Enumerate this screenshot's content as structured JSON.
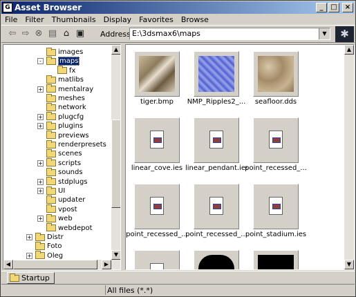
{
  "window": {
    "title": "Asset Browser",
    "icon": "3ds-max-icon",
    "controls": [
      "_",
      "□",
      "×"
    ]
  },
  "menu": [
    "File",
    "Filter",
    "Thumbnails",
    "Display",
    "Favorites",
    "Browse"
  ],
  "toolbar": {
    "icons": [
      "back-arrow-icon",
      "forward-arrow-icon",
      "stop-icon",
      "refresh-icon",
      "home-icon",
      "up-folder-icon"
    ],
    "address_label": "Address:",
    "address_value": "E:\\3dsmax6\\maps",
    "logo": "3ds-max-logo-icon"
  },
  "tree": {
    "items": [
      {
        "label": "images",
        "depth": 2,
        "expander": ""
      },
      {
        "label": "maps",
        "depth": 2,
        "expander": "-",
        "selected": true
      },
      {
        "label": "fx",
        "depth": 3,
        "expander": ""
      },
      {
        "label": "matlibs",
        "depth": 2,
        "expander": ""
      },
      {
        "label": "mentalray",
        "depth": 2,
        "expander": "+"
      },
      {
        "label": "meshes",
        "depth": 2,
        "expander": ""
      },
      {
        "label": "network",
        "depth": 2,
        "expander": ""
      },
      {
        "label": "plugcfg",
        "depth": 2,
        "expander": "+"
      },
      {
        "label": "plugins",
        "depth": 2,
        "expander": "+"
      },
      {
        "label": "previews",
        "depth": 2,
        "expander": ""
      },
      {
        "label": "renderpresets",
        "depth": 2,
        "expander": ""
      },
      {
        "label": "scenes",
        "depth": 2,
        "expander": ""
      },
      {
        "label": "scripts",
        "depth": 2,
        "expander": "+"
      },
      {
        "label": "sounds",
        "depth": 2,
        "expander": ""
      },
      {
        "label": "stdplugs",
        "depth": 2,
        "expander": "+"
      },
      {
        "label": "UI",
        "depth": 2,
        "expander": "+"
      },
      {
        "label": "updater",
        "depth": 2,
        "expander": ""
      },
      {
        "label": "vpost",
        "depth": 2,
        "expander": ""
      },
      {
        "label": "web",
        "depth": 2,
        "expander": "+"
      },
      {
        "label": "webdepot",
        "depth": 2,
        "expander": ""
      },
      {
        "label": "Distr",
        "depth": 1,
        "expander": "+"
      },
      {
        "label": "Foto",
        "depth": 1,
        "expander": ""
      },
      {
        "label": "Oleg",
        "depth": 1,
        "expander": "+"
      }
    ]
  },
  "files": [
    {
      "name": "tiger.bmp",
      "kind": "image",
      "thumb": "tiger-sketch"
    },
    {
      "name": "NMP_Ripples2_...",
      "kind": "image",
      "thumb": "ripples-blue"
    },
    {
      "name": "seafloor.dds",
      "kind": "image",
      "thumb": "seafloor-texture"
    },
    {
      "name": "linear_cove.ies",
      "kind": "doc"
    },
    {
      "name": "linear_pendant.ies",
      "kind": "doc"
    },
    {
      "name": "point_recessed_...",
      "kind": "doc"
    },
    {
      "name": "point_recessed_...",
      "kind": "doc"
    },
    {
      "name": "point_recessed_...",
      "kind": "doc"
    },
    {
      "name": "point_stadium.ies",
      "kind": "doc"
    },
    {
      "name": "",
      "kind": "doc"
    },
    {
      "name": "",
      "kind": "image",
      "thumb": "dark-silhouette"
    },
    {
      "name": "",
      "kind": "image",
      "thumb": "leaf-silhouette"
    }
  ],
  "tabs": [
    {
      "label": "Startup",
      "icon": "folder-icon"
    }
  ],
  "status": {
    "filter_text": "All files (*.*)"
  },
  "colors": {
    "title_gradient_start": "#0a246a",
    "title_gradient_end": "#a6caf0",
    "folder_yellow": "#f1d775",
    "selection": "#0a246a"
  }
}
